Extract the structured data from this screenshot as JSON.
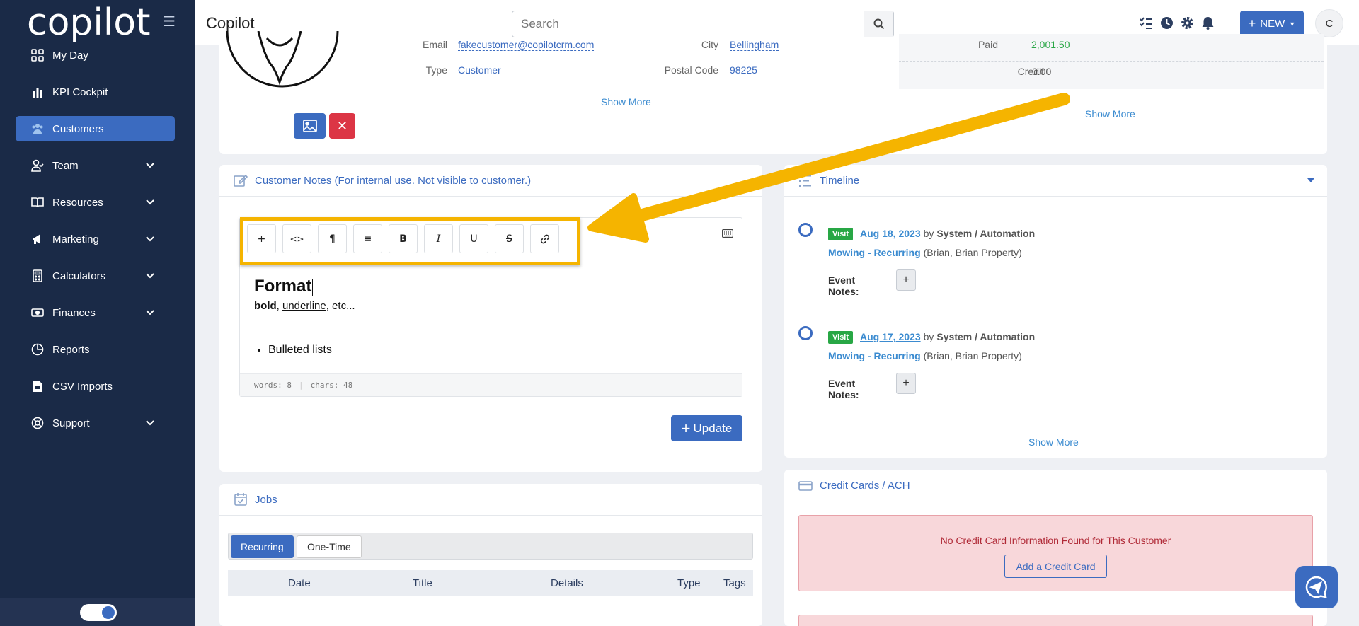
{
  "app": {
    "logo_text_a": "co",
    "logo_text_b": "pilot",
    "title": "Copilot"
  },
  "sidebar": {
    "items": [
      {
        "label": "My Day",
        "icon": "grid-icon"
      },
      {
        "label": "KPI Cockpit",
        "icon": "bar-chart-icon"
      },
      {
        "label": "Customers",
        "icon": "users-icon",
        "active": true
      },
      {
        "label": "Team",
        "icon": "user-icon",
        "expandable": true
      },
      {
        "label": "Resources",
        "icon": "book-icon",
        "expandable": true
      },
      {
        "label": "Marketing",
        "icon": "megaphone-icon",
        "expandable": true
      },
      {
        "label": "Calculators",
        "icon": "calculator-icon",
        "expandable": true
      },
      {
        "label": "Finances",
        "icon": "money-icon",
        "expandable": true
      },
      {
        "label": "Reports",
        "icon": "pie-chart-icon"
      },
      {
        "label": "CSV Imports",
        "icon": "csv-file-icon"
      },
      {
        "label": "Support",
        "icon": "lifebuoy-icon",
        "expandable": true
      }
    ]
  },
  "search": {
    "placeholder": "Search",
    "value": ""
  },
  "header": {
    "new_label": "NEW",
    "avatar_initial": "C"
  },
  "profile": {
    "email_label": "Email",
    "email_value": "fakecustomer@copilotcrm.com",
    "type_label": "Type",
    "type_value": "Customer",
    "city_label": "City",
    "city_value": "Bellingham",
    "postal_label": "Postal Code",
    "postal_value": "98225",
    "paid_label": "Paid",
    "paid_value": "2,001.50",
    "credit_label": "Credit",
    "credit_value": "0.00",
    "show_more": "Show More",
    "show_more_right": "Show More"
  },
  "notes": {
    "title": "Customer Notes (For internal use. Not visible to customer.)",
    "toolbar": [
      "+",
      "<>",
      "¶",
      "≡",
      "B",
      "I",
      "U",
      "S",
      "link"
    ],
    "heading": "Format",
    "line_bold": "bold",
    "line_sep1": ", ",
    "line_underline": "underline",
    "line_rest": ", etc...",
    "bullet": "Bulleted lists",
    "words": "words: 8",
    "chars": "chars: 48",
    "update_label": "Update"
  },
  "timeline": {
    "title": "Timeline",
    "items": [
      {
        "badge": "Visit",
        "date": "Aug 18, 2023",
        "by": "by",
        "who": "System / Automation",
        "job": "Mowing - Recurring",
        "detail": "(Brian, Brian Property)",
        "notes_label": "Event Notes:"
      },
      {
        "badge": "Visit",
        "date": "Aug 17, 2023",
        "by": "by",
        "who": "System / Automation",
        "job": "Mowing - Recurring",
        "detail": "(Brian, Brian Property)",
        "notes_label": "Event Notes:"
      }
    ],
    "show_more": "Show More"
  },
  "jobs": {
    "title": "Jobs",
    "tabs": [
      "Recurring",
      "One-Time"
    ],
    "columns": [
      "Date",
      "Title",
      "Details",
      "Type",
      "Tags"
    ]
  },
  "credit_cards": {
    "title": "Credit Cards / ACH",
    "empty_text": "No Credit Card Information Found for This Customer",
    "add_label": "Add a Credit Card"
  },
  "colors": {
    "sidebar_bg": "#1a2a47",
    "accent": "#3b6bc0",
    "highlight": "#f5b400",
    "danger": "#dc3545",
    "success": "#28a745"
  }
}
